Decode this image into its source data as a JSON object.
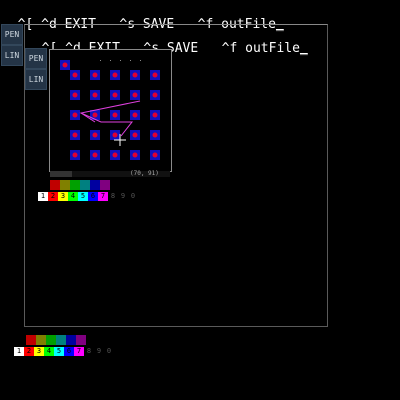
{
  "header": {
    "text": "^[ ^d EXIT   ^s SAVE   ^f outFile",
    "cursor": "_"
  },
  "inner_header": {
    "text": "^[ ^d EXIT   ^s SAVE   ^f outFile",
    "cursor": "_"
  },
  "tools": [
    {
      "label": "PEN"
    },
    {
      "label": "LIN"
    }
  ],
  "canvas": {
    "dot_color": "#e00030",
    "square_color": "#1010c0",
    "line_color": "#e040e0",
    "status": "(70,  91)"
  },
  "palette_top": {
    "colors": [
      "#c00000",
      "#808000",
      "#00a000",
      "#008080",
      "#0000a0",
      "#800080"
    ],
    "numbers": [
      {
        "n": "1",
        "bg": "#ffffff",
        "dim": false
      },
      {
        "n": "2",
        "bg": "#ff0000",
        "dim": false
      },
      {
        "n": "3",
        "bg": "#ffff00",
        "dim": false
      },
      {
        "n": "4",
        "bg": "#00ff00",
        "dim": false
      },
      {
        "n": "5",
        "bg": "#00ffff",
        "dim": false
      },
      {
        "n": "6",
        "bg": "#0000ff",
        "dim": false
      },
      {
        "n": "7",
        "bg": "#ff00ff",
        "dim": false
      },
      {
        "n": "8",
        "bg": "",
        "dim": true
      },
      {
        "n": "9",
        "bg": "",
        "dim": true
      },
      {
        "n": "0",
        "bg": "",
        "dim": true
      }
    ]
  },
  "palette_bottom": {
    "colors": [
      "#c00000",
      "#808000",
      "#00a000",
      "#008080",
      "#0000a0",
      "#800080"
    ],
    "numbers": [
      {
        "n": "1",
        "bg": "#ffffff",
        "dim": false
      },
      {
        "n": "2",
        "bg": "#ff0000",
        "dim": false
      },
      {
        "n": "3",
        "bg": "#ffff00",
        "dim": false
      },
      {
        "n": "4",
        "bg": "#00ff00",
        "dim": false
      },
      {
        "n": "5",
        "bg": "#00ffff",
        "dim": false
      },
      {
        "n": "6",
        "bg": "#0000ff",
        "dim": false
      },
      {
        "n": "7",
        "bg": "#ff00ff",
        "dim": false
      },
      {
        "n": "8",
        "bg": "",
        "dim": true
      },
      {
        "n": "9",
        "bg": "",
        "dim": true
      },
      {
        "n": "0",
        "bg": "",
        "dim": true
      }
    ]
  }
}
